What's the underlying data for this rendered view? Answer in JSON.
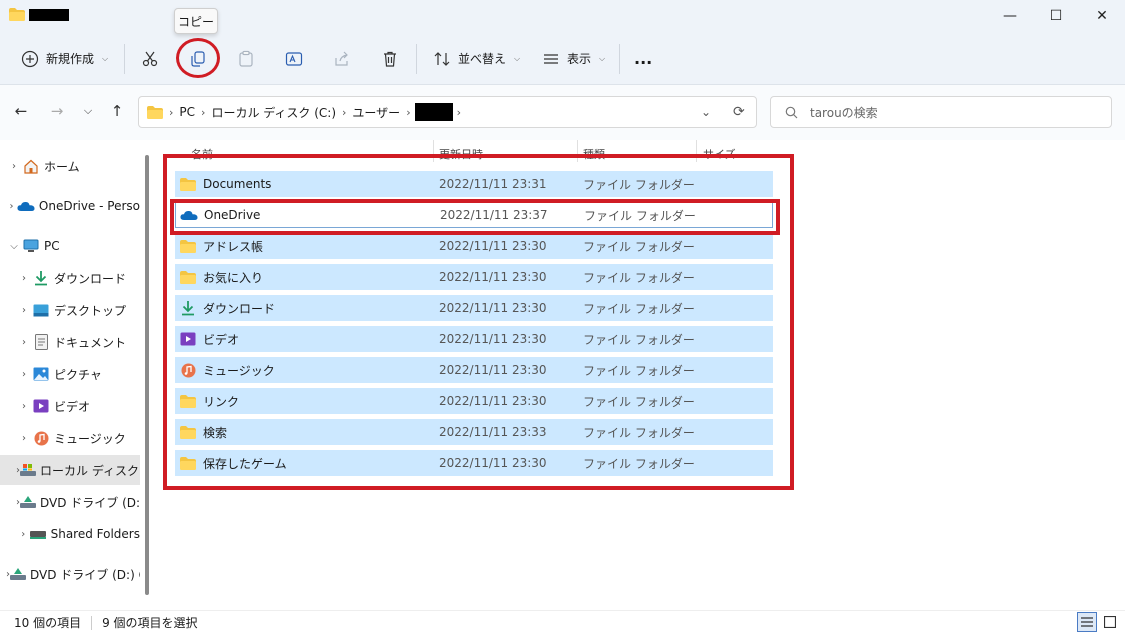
{
  "window": {
    "minimize": "—",
    "maximize": "☐",
    "close": "✕"
  },
  "tooltip": "コピー",
  "toolbar": {
    "new_label": "新規作成",
    "sort_label": "並べ替え",
    "view_label": "表示",
    "more_label": "..."
  },
  "address": {
    "segments": [
      "PC",
      "ローカル ディスク (C:)",
      "ユーザー"
    ],
    "history_glyph": "⌄",
    "refresh_glyph": "⟳"
  },
  "search": {
    "placeholder": "tarouの検索"
  },
  "nav": {
    "items": [
      {
        "label": "ホーム",
        "icon": "home-icon"
      },
      {
        "label": "OneDrive - Perso",
        "icon": "onedrive-icon"
      },
      {
        "label": "PC",
        "icon": "pc-icon"
      },
      {
        "label": "ダウンロード",
        "icon": "download-icon"
      },
      {
        "label": "デスクトップ",
        "icon": "desktop-icon"
      },
      {
        "label": "ドキュメント",
        "icon": "document-icon"
      },
      {
        "label": "ピクチャ",
        "icon": "picture-icon"
      },
      {
        "label": "ビデオ",
        "icon": "video-icon"
      },
      {
        "label": "ミュージック",
        "icon": "music-icon"
      },
      {
        "label": "ローカル ディスク (",
        "icon": "disk-icon"
      },
      {
        "label": "DVD ドライブ (D:)",
        "icon": "dvd-icon"
      },
      {
        "label": "Shared Folders",
        "icon": "shared-drive-icon"
      },
      {
        "label": "DVD ドライブ (D:) C",
        "icon": "dvd-icon"
      }
    ]
  },
  "columns": {
    "name": "名前",
    "date": "更新日時",
    "type": "種類",
    "size": "サイズ"
  },
  "files": [
    {
      "name": "Documents",
      "date": "2022/11/11 23:31",
      "type": "ファイル フォルダー",
      "icon": "folder-icon"
    },
    {
      "name": "OneDrive",
      "date": "2022/11/11 23:37",
      "type": "ファイル フォルダー",
      "icon": "onedrive-icon"
    },
    {
      "name": "アドレス帳",
      "date": "2022/11/11 23:30",
      "type": "ファイル フォルダー",
      "icon": "folder-icon"
    },
    {
      "name": "お気に入り",
      "date": "2022/11/11 23:30",
      "type": "ファイル フォルダー",
      "icon": "folder-icon"
    },
    {
      "name": "ダウンロード",
      "date": "2022/11/11 23:30",
      "type": "ファイル フォルダー",
      "icon": "download-icon"
    },
    {
      "name": "ビデオ",
      "date": "2022/11/11 23:30",
      "type": "ファイル フォルダー",
      "icon": "video-icon"
    },
    {
      "name": "ミュージック",
      "date": "2022/11/11 23:30",
      "type": "ファイル フォルダー",
      "icon": "music-icon"
    },
    {
      "name": "リンク",
      "date": "2022/11/11 23:30",
      "type": "ファイル フォルダー",
      "icon": "folder-icon"
    },
    {
      "name": "検索",
      "date": "2022/11/11 23:33",
      "type": "ファイル フォルダー",
      "icon": "folder-icon"
    },
    {
      "name": "保存したゲーム",
      "date": "2022/11/11 23:30",
      "type": "ファイル フォルダー",
      "icon": "folder-icon"
    }
  ],
  "status": {
    "count": "10 個の項目",
    "selected": "9 個の項目を選択"
  },
  "colors": {
    "selection": "#cce8ff",
    "annotation_red": "#d01c24",
    "chrome": "#eef3f9"
  }
}
